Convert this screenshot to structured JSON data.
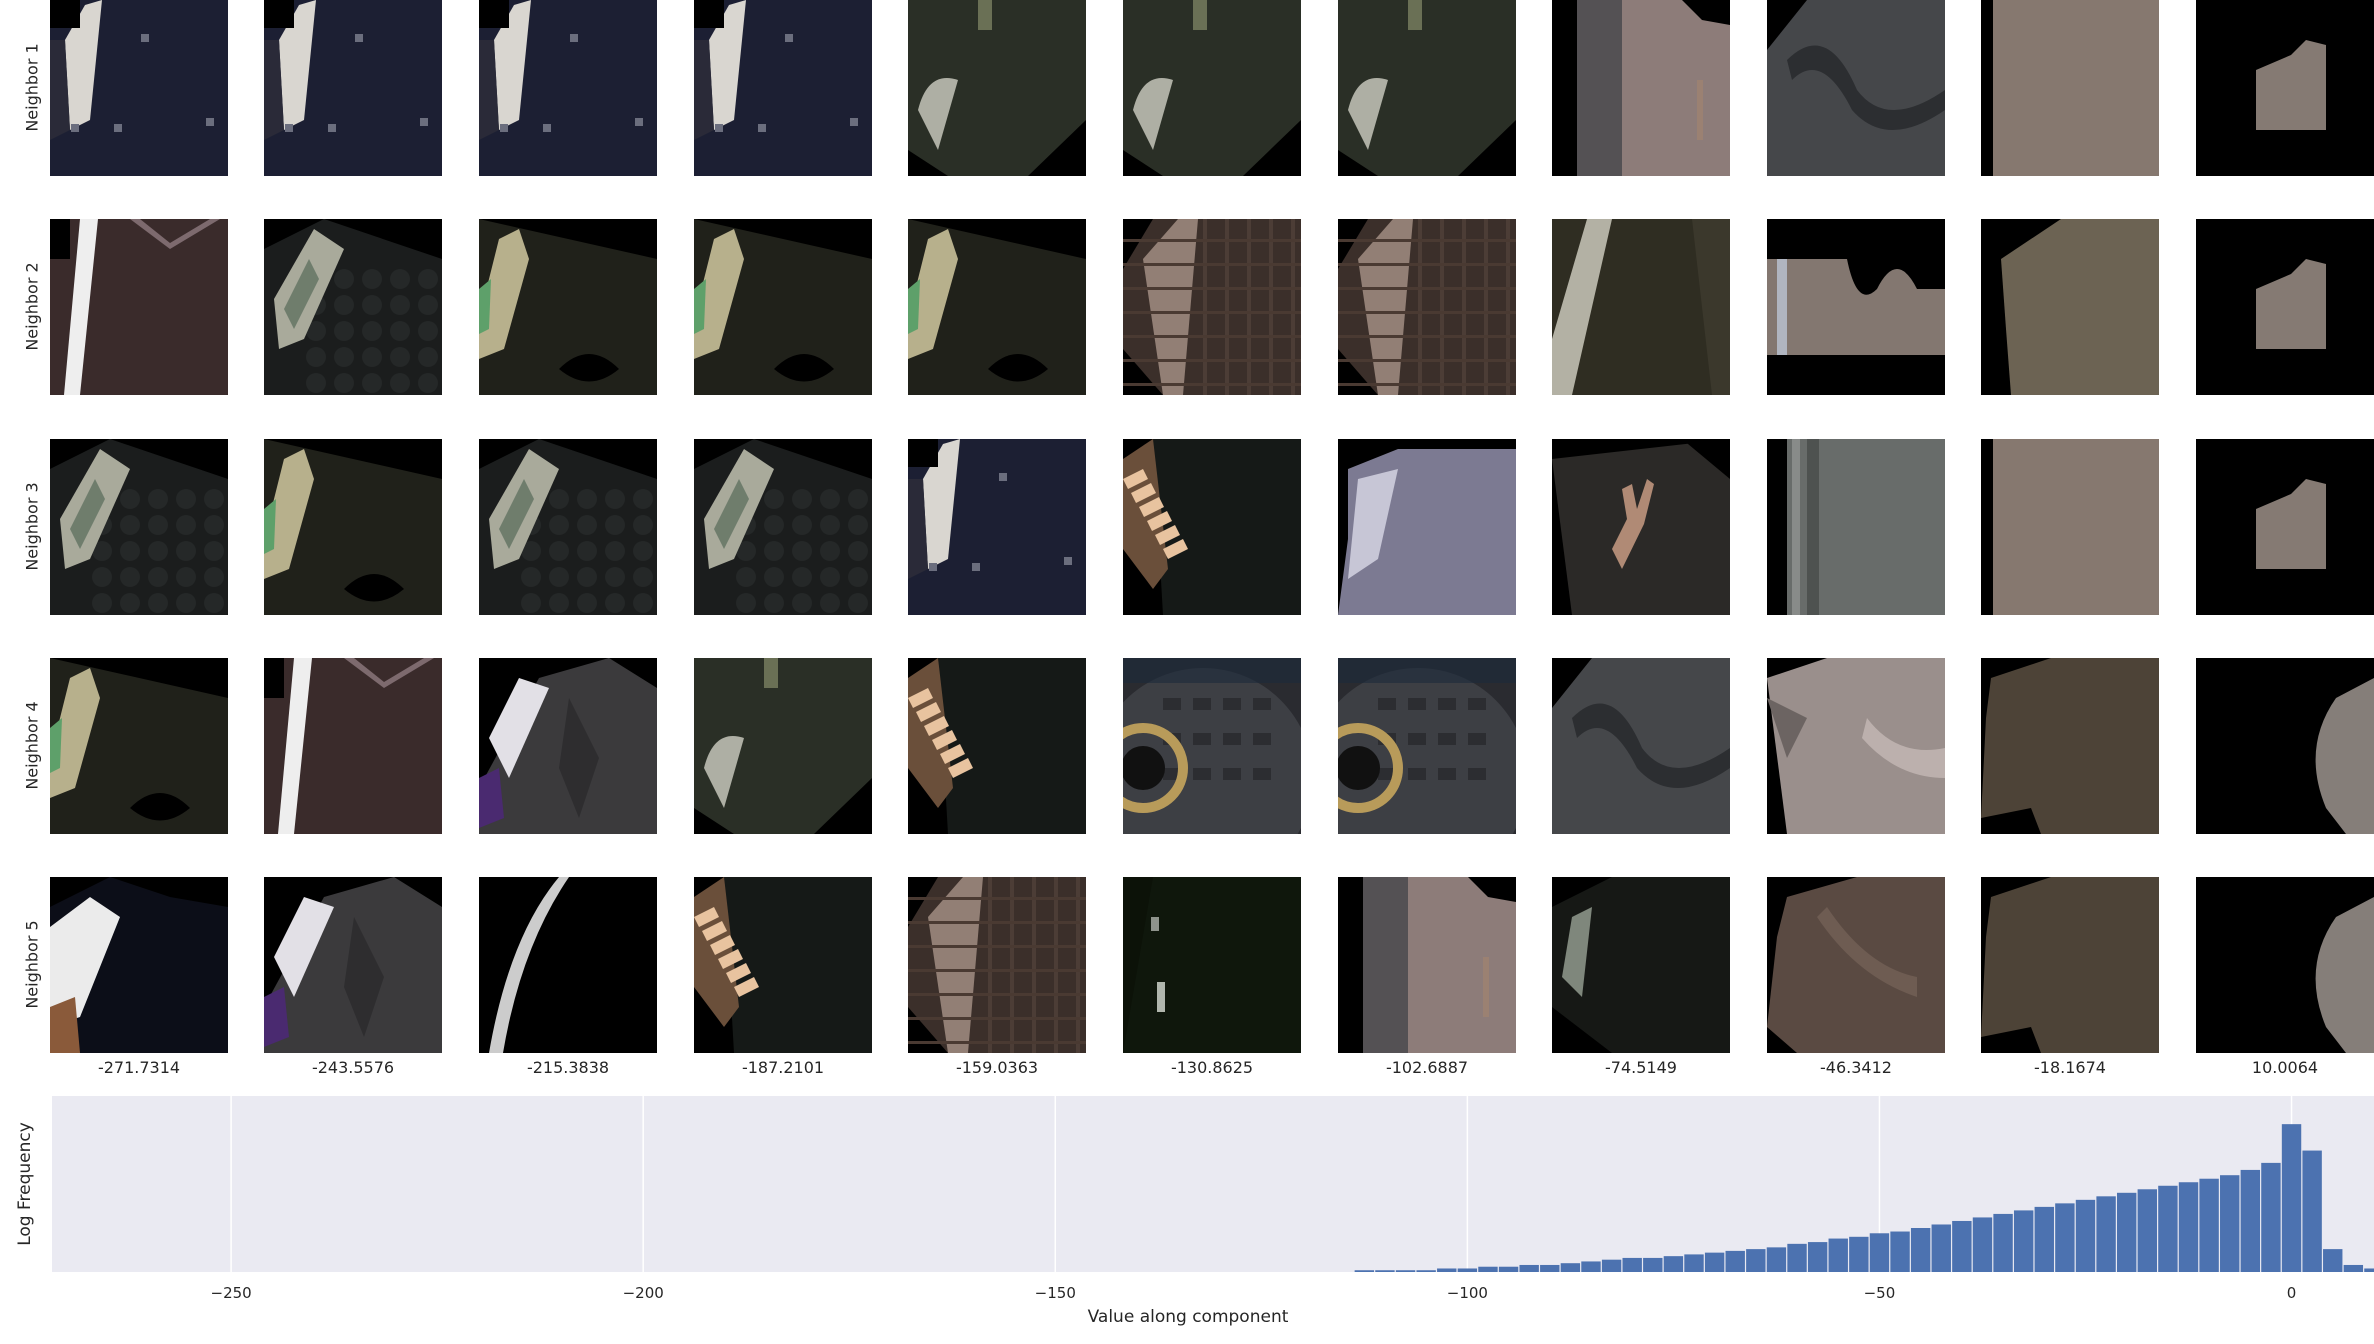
{
  "row_labels": [
    "Neighbor 1",
    "Neighbor 2",
    "Neighbor 3",
    "Neighbor 4",
    "Neighbor 5"
  ],
  "column_values": [
    "-271.7314",
    "-243.5576",
    "-215.3838",
    "-187.2101",
    "-159.0363",
    "-130.8625",
    "-102.6887",
    "-74.5149",
    "-46.3412",
    "-18.1674",
    "10.0064"
  ],
  "tile_grid": [
    [
      "dark-jacket-white-stripe",
      "dark-jacket-white-stripe",
      "dark-jacket-white-stripe",
      "dark-jacket-white-stripe",
      "dark-green-shape",
      "dark-green-shape",
      "dark-green-shape",
      "pink-fabric",
      "grey-fabric",
      "taupe-fabric",
      "taupe-shape-small"
    ],
    [
      "maroon-vneck-stripe",
      "dark-knit-collar",
      "dark-green-collar",
      "dark-green-collar",
      "dark-green-collar",
      "brown-plaid",
      "brown-plaid",
      "olive-fabric-stripe",
      "taupe-shape-wave",
      "taupe-shape",
      "taupe-shape-small"
    ],
    [
      "dark-knit-collar",
      "dark-green-collar",
      "dark-knit-collar",
      "dark-knit-collar",
      "dark-jacket-white-stripe",
      "dark-striped-corner",
      "lavender-fabric",
      "brown-antler",
      "grey-fabric-stripe",
      "taupe-fabric",
      "taupe-shape-small"
    ],
    [
      "dark-green-collar",
      "maroon-vneck-stripe",
      "grey-suit",
      "dark-green-shape",
      "dark-striped-corner",
      "tire",
      "tire",
      "grey-fabric",
      "pale-pink-fabric",
      "brown-shape",
      "grey-half-circle"
    ],
    [
      "black-white-sleeve",
      "grey-suit",
      "white-arc",
      "dark-striped-corner",
      "brown-plaid",
      "dark-night",
      "pink-fabric",
      "black-green-shape",
      "brown-textured",
      "brown-shape",
      "grey-half-circle"
    ]
  ],
  "colors": {
    "bar": "#4c72b0",
    "plot_bg": "#eaeaf2",
    "grid": "#ffffff"
  },
  "chart_data": {
    "type": "bar",
    "title": "",
    "xlabel": "Value along component",
    "ylabel": "Log Frequency",
    "xlim": [
      -271.7314,
      10.0064
    ],
    "xticks": [
      -250,
      -200,
      -150,
      -100,
      -50,
      0
    ],
    "xtick_labels": [
      "−250",
      "−200",
      "−150",
      "−100",
      "−50",
      "0"
    ],
    "yticks": [],
    "ylim": [
      0,
      1
    ],
    "bin_width": 2.5,
    "bins": [
      {
        "x": -112.5,
        "y": 0.01
      },
      {
        "x": -110,
        "y": 0.01
      },
      {
        "x": -107.5,
        "y": 0.01
      },
      {
        "x": -105,
        "y": 0.01
      },
      {
        "x": -102.5,
        "y": 0.02
      },
      {
        "x": -100,
        "y": 0.02
      },
      {
        "x": -97.5,
        "y": 0.03
      },
      {
        "x": -95,
        "y": 0.03
      },
      {
        "x": -92.5,
        "y": 0.04
      },
      {
        "x": -90,
        "y": 0.04
      },
      {
        "x": -87.5,
        "y": 0.05
      },
      {
        "x": -85,
        "y": 0.06
      },
      {
        "x": -82.5,
        "y": 0.07
      },
      {
        "x": -80,
        "y": 0.08
      },
      {
        "x": -77.5,
        "y": 0.08
      },
      {
        "x": -75,
        "y": 0.09
      },
      {
        "x": -72.5,
        "y": 0.1
      },
      {
        "x": -70,
        "y": 0.11
      },
      {
        "x": -67.5,
        "y": 0.12
      },
      {
        "x": -65,
        "y": 0.13
      },
      {
        "x": -62.5,
        "y": 0.14
      },
      {
        "x": -60,
        "y": 0.16
      },
      {
        "x": -57.5,
        "y": 0.17
      },
      {
        "x": -55,
        "y": 0.19
      },
      {
        "x": -52.5,
        "y": 0.2
      },
      {
        "x": -50,
        "y": 0.22
      },
      {
        "x": -47.5,
        "y": 0.23
      },
      {
        "x": -45,
        "y": 0.25
      },
      {
        "x": -42.5,
        "y": 0.27
      },
      {
        "x": -40,
        "y": 0.29
      },
      {
        "x": -37.5,
        "y": 0.31
      },
      {
        "x": -35,
        "y": 0.33
      },
      {
        "x": -32.5,
        "y": 0.35
      },
      {
        "x": -30,
        "y": 0.37
      },
      {
        "x": -27.5,
        "y": 0.39
      },
      {
        "x": -25,
        "y": 0.41
      },
      {
        "x": -22.5,
        "y": 0.43
      },
      {
        "x": -20,
        "y": 0.45
      },
      {
        "x": -17.5,
        "y": 0.47
      },
      {
        "x": -15,
        "y": 0.49
      },
      {
        "x": -12.5,
        "y": 0.51
      },
      {
        "x": -10,
        "y": 0.53
      },
      {
        "x": -7.5,
        "y": 0.55
      },
      {
        "x": -5,
        "y": 0.58
      },
      {
        "x": -2.5,
        "y": 0.62
      },
      {
        "x": 0,
        "y": 0.84
      },
      {
        "x": 2.5,
        "y": 0.69
      },
      {
        "x": 5,
        "y": 0.13
      },
      {
        "x": 7.5,
        "y": 0.04
      },
      {
        "x": 10,
        "y": 0.02
      }
    ]
  }
}
